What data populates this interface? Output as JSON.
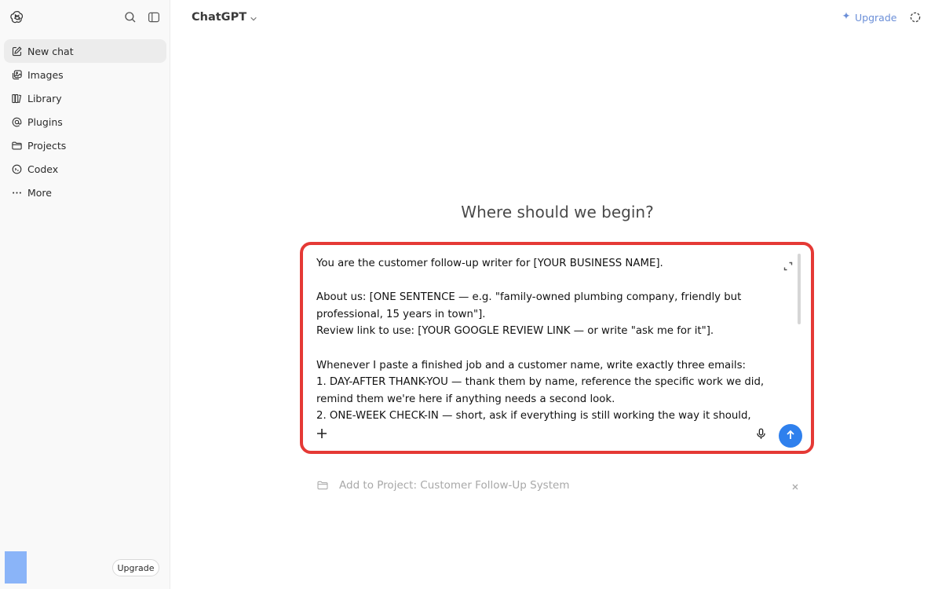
{
  "sidebar": {
    "logo_icon": "openai-logo-icon",
    "search_icon": "search-icon",
    "toggle_icon": "sidebar-toggle-icon",
    "items": [
      {
        "label": "New chat",
        "icon": "compose-icon"
      },
      {
        "label": "Images",
        "icon": "images-icon"
      },
      {
        "label": "Library",
        "icon": "library-icon"
      },
      {
        "label": "Plugins",
        "icon": "at-sign-icon"
      },
      {
        "label": "Projects",
        "icon": "folder-icon"
      },
      {
        "label": "Codex",
        "icon": "codex-icon"
      },
      {
        "label": "More",
        "icon": "more-dots-icon"
      }
    ],
    "upgrade_label": "Upgrade"
  },
  "header": {
    "model_label": "ChatGPT",
    "upgrade_label": "Upgrade"
  },
  "main": {
    "heading": "Where should we begin?",
    "composer": {
      "text": "You are the customer follow-up writer for [YOUR BUSINESS NAME].\n\nAbout us: [ONE SENTENCE — e.g. \"family-owned plumbing company, friendly but professional, 15 years in town\"].\nReview link to use: [YOUR GOOGLE REVIEW LINK — or write \"ask me for it\"].\n\nWhenever I paste a finished job and a customer name, write exactly three emails:\n1. DAY-AFTER THANK-YOU — thank them by name, reference the specific work we did, remind them we're here if anything needs a second look.\n2. ONE-WEEK CHECK-IN — short, ask if everything is still working the way it should,"
    },
    "project_label": "Add to Project: Customer Follow-Up System"
  },
  "colors": {
    "accent": "#2f80ed",
    "highlight_outline": "#e53935",
    "upgrade_text": "#6b8fd8"
  }
}
